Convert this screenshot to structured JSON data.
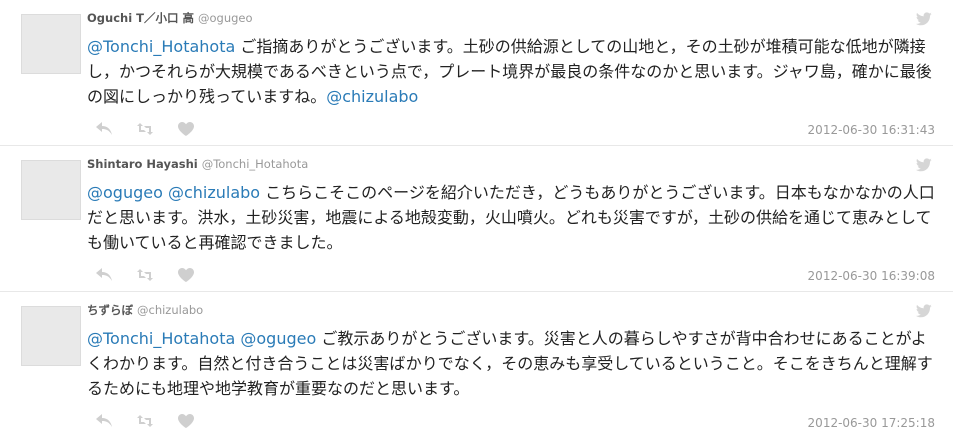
{
  "tweets": [
    {
      "name": "Oguchi T／小口 高",
      "handle": "@ogugeo",
      "segments": [
        {
          "type": "mention",
          "text": "@Tonchi_Hotahota"
        },
        {
          "type": "text",
          "text": " ご指摘ありがとうございます。土砂の供給源としての山地と，その土砂が堆積可能な低地が隣接し，かつそれらが大規模であるべきという点で，プレート境界が最良の条件なのかと思います。ジャワ島，確かに最後の図にしっかり残っていますね。"
        },
        {
          "type": "mention",
          "text": "@chizulabo"
        }
      ],
      "timestamp": "2012-06-30 16:31:43"
    },
    {
      "name": "Shintaro Hayashi",
      "handle": "@Tonchi_Hotahota",
      "segments": [
        {
          "type": "mention",
          "text": "@ogugeo"
        },
        {
          "type": "text",
          "text": " "
        },
        {
          "type": "mention",
          "text": "@chizulabo"
        },
        {
          "type": "text",
          "text": " こちらこそこのページを紹介いただき，どうもありがとうございます。日本もなかなかの人口だと思います。洪水，土砂災害，地震による地殻変動，火山噴火。どれも災害ですが，土砂の供給を通じて恵みとしても働いていると再確認できました。"
        }
      ],
      "timestamp": "2012-06-30 16:39:08"
    },
    {
      "name": "ちずらぼ",
      "handle": "@chizulabo",
      "segments": [
        {
          "type": "mention",
          "text": "@Tonchi_Hotahota"
        },
        {
          "type": "text",
          "text": " "
        },
        {
          "type": "mention",
          "text": "@ogugeo"
        },
        {
          "type": "text",
          "text": " ご教示ありがとうございます。災害と人の暮らしやすさが背中合わせにあることがよくわかります。自然と付き合うことは災害ばかりでなく，その恵みも享受しているということ。そこをきちんと理解するためにも地理や地学教育が重要なのだと思います。"
        }
      ],
      "timestamp": "2012-06-30 17:25:18"
    }
  ],
  "icons": {
    "reply": "reply-icon",
    "retweet": "retweet-icon",
    "favorite": "heart-icon",
    "bird": "twitter-bird-icon"
  },
  "colors": {
    "mention": "#2a7bb7",
    "icon": "#cccccc",
    "timestamp": "#999999"
  }
}
